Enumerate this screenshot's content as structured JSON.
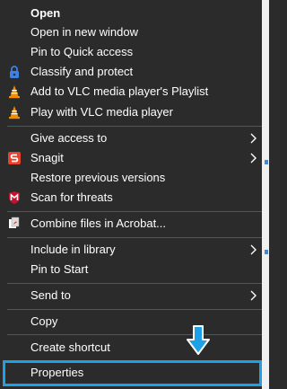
{
  "menu": {
    "open": "Open",
    "open_new_window": "Open in new window",
    "pin_quick_access": "Pin to Quick access",
    "classify_protect": "Classify and protect",
    "vlc_add_playlist": "Add to VLC media player's Playlist",
    "vlc_play": "Play with VLC media player",
    "give_access": "Give access to",
    "snagit": "Snagit",
    "restore_versions": "Restore previous versions",
    "scan_threats": "Scan for threats",
    "combine_acrobat": "Combine files in Acrobat...",
    "include_library": "Include in library",
    "pin_start": "Pin to Start",
    "send_to": "Send to",
    "copy": "Copy",
    "create_shortcut": "Create shortcut",
    "properties": "Properties"
  },
  "icons": {
    "classify": "lock-shield-icon",
    "vlc": "vlc-cone-icon",
    "snagit": "snagit-icon",
    "mcafee": "mcafee-shield-icon",
    "acrobat": "acrobat-icon",
    "submenu": "chevron-right-icon",
    "callout": "arrow-down-icon"
  },
  "colors": {
    "background": "#2b2b2b",
    "text": "#ffffff",
    "separator": "#555555",
    "highlight_border": "#1ea0e6",
    "vlc_orange": "#f08c00",
    "snagit_red": "#e8432f",
    "mcafee_red": "#c8102e",
    "classify_blue": "#3c82e6"
  }
}
